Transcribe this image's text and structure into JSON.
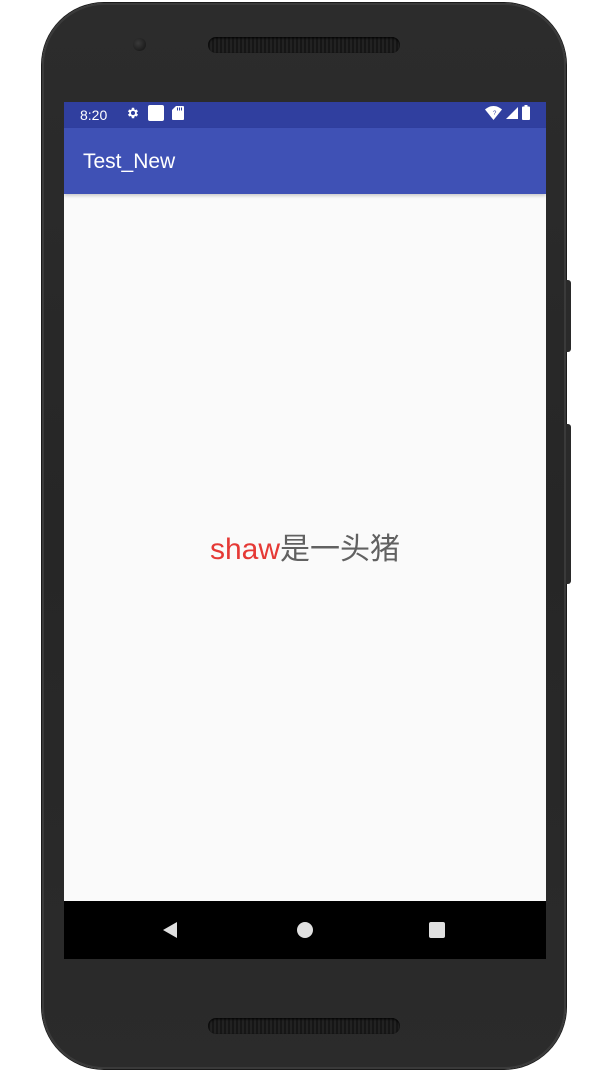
{
  "status_bar": {
    "time": "8:20",
    "left_icons": [
      "settings-icon",
      "square-notification-icon",
      "sd-card-icon"
    ],
    "right_icons": [
      "wifi-icon",
      "cell-signal-icon",
      "battery-icon"
    ],
    "background_color": "#303f9f"
  },
  "app_bar": {
    "title": "Test_New",
    "background_color": "#3f51b5"
  },
  "content": {
    "message_highlight": "shaw",
    "message_rest": "是一头猪",
    "highlight_color": "#e53935",
    "text_color": "#616161"
  },
  "nav_bar": {
    "buttons": [
      "back-icon",
      "home-icon",
      "recents-icon"
    ]
  }
}
